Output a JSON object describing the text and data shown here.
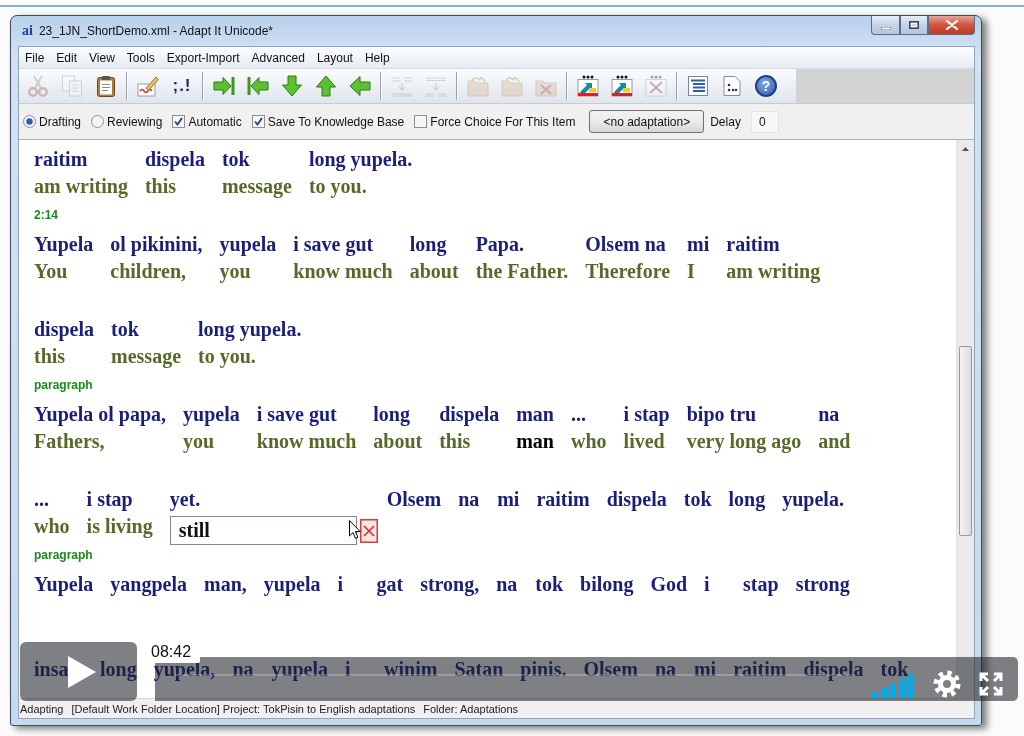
{
  "window": {
    "logo": "ai",
    "title": "23_1JN_ShortDemo.xml - Adapt It Unicode*"
  },
  "menu": [
    "File",
    "Edit",
    "View",
    "Tools",
    "Export-Import",
    "Advanced",
    "Layout",
    "Help"
  ],
  "toolbar": [
    [
      {
        "kind": "cut",
        "disabled": true
      },
      {
        "kind": "copy",
        "disabled": true
      },
      {
        "kind": "paste",
        "disabled": false
      }
    ],
    [
      {
        "kind": "pen-sheet",
        "disabled": false
      },
      {
        "kind": "text",
        "label": ";.!",
        "disabled": false
      }
    ],
    [
      {
        "kind": "jump-forward",
        "disabled": false
      },
      {
        "kind": "jump-back",
        "disabled": false
      },
      {
        "kind": "down",
        "disabled": false
      },
      {
        "kind": "up",
        "disabled": false
      },
      {
        "kind": "left",
        "disabled": false
      }
    ],
    [
      {
        "kind": "merge",
        "disabled": true
      },
      {
        "kind": "split",
        "disabled": true
      }
    ],
    [
      {
        "kind": "folder",
        "disabled": true
      },
      {
        "kind": "folder",
        "disabled": true
      },
      {
        "kind": "folder-cross",
        "disabled": true
      }
    ],
    [
      {
        "kind": "picture-arrow",
        "disabled": false
      },
      {
        "kind": "picture-arrow",
        "disabled": false
      },
      {
        "kind": "picture-cross",
        "disabled": true
      }
    ],
    [
      {
        "kind": "list",
        "disabled": false
      },
      {
        "kind": "sheet-dots",
        "disabled": false
      },
      {
        "kind": "help",
        "label": "?",
        "disabled": false
      }
    ]
  ],
  "modes": [
    {
      "label": "Drafting",
      "selected": true
    },
    {
      "label": "Reviewing",
      "selected": false
    }
  ],
  "options": [
    {
      "label": "Automatic",
      "checked": true
    },
    {
      "label": "Save To Knowledge Base",
      "checked": true
    },
    {
      "label": "Force Choice For This Item",
      "checked": false
    }
  ],
  "adaptation_button": "<no adaptation>",
  "delay": {
    "label": "Delay",
    "value": "0"
  },
  "strips": [
    {
      "piles": [
        {
          "source": "raitim",
          "target": "am writing"
        },
        {
          "source": "dispela",
          "target": "this"
        },
        {
          "source": "tok",
          "target": "message"
        },
        {
          "source": "long yupela.",
          "target": "to you."
        }
      ],
      "marker": "2:14"
    },
    {
      "piles": [
        {
          "source": "Yupela",
          "target": "You"
        },
        {
          "source": "ol pikinini,",
          "target": "children,"
        },
        {
          "source": "yupela",
          "target": "you"
        },
        {
          "source": "i save gut",
          "target": "know much"
        },
        {
          "source": "long",
          "target": "about"
        },
        {
          "source": "Papa.",
          "target": "the Father."
        },
        {
          "source": "Olsem na",
          "target": "Therefore"
        },
        {
          "source": "mi",
          "target": "I"
        },
        {
          "source": "raitim",
          "target": "am writing"
        }
      ]
    },
    {
      "piles": [
        {
          "source": "dispela",
          "target": "this"
        },
        {
          "source": "tok",
          "target": "message"
        },
        {
          "source": "long yupela.",
          "target": "to you."
        }
      ],
      "marker": "paragraph"
    },
    {
      "piles": [
        {
          "source": "Yupela ol papa,",
          "target": "Fathers,"
        },
        {
          "source": "yupela",
          "target": "you"
        },
        {
          "source": "i save gut",
          "target": "know much"
        },
        {
          "source": "long",
          "target": "about"
        },
        {
          "source": "dispela",
          "target": "this"
        },
        {
          "source": "man",
          "target": "man",
          "color": "#000000"
        },
        {
          "source": "...",
          "target": "who"
        },
        {
          "source": "i stap",
          "target": "lived"
        },
        {
          "source": "bipo tru",
          "target": "very long ago"
        },
        {
          "source": "na",
          "target": "and"
        }
      ]
    },
    {
      "piles": [
        {
          "source": "...",
          "target": "who"
        },
        {
          "source": "i stap",
          "target": "is living"
        },
        {
          "source": "yet.",
          "phrase_box": "still"
        },
        {
          "source": "Olsem"
        },
        {
          "source": "na"
        },
        {
          "source": "mi"
        },
        {
          "source": "raitim"
        },
        {
          "source": "dispela"
        },
        {
          "source": "tok"
        },
        {
          "source": "long"
        },
        {
          "source": "yupela."
        }
      ],
      "marker": "paragraph"
    },
    {
      "piles": [
        {
          "source": "Yupela"
        },
        {
          "source": "yangpela"
        },
        {
          "source": "man,"
        },
        {
          "source": "yupela"
        },
        {
          "source": "i"
        },
        {
          "source": "gat"
        },
        {
          "source": "strong,"
        },
        {
          "source": "na"
        },
        {
          "source": "tok"
        },
        {
          "source": "bilong"
        },
        {
          "source": "God"
        },
        {
          "source": "i"
        },
        {
          "source": "stap"
        },
        {
          "source": "strong"
        }
      ]
    },
    {
      "piles": [
        {
          "source": "insa"
        },
        {
          "source": "long"
        },
        {
          "source": "yupela,"
        },
        {
          "source": "na"
        },
        {
          "source": "yupela"
        },
        {
          "source": "i"
        },
        {
          "source": "winim"
        },
        {
          "source": "Satan"
        },
        {
          "source": "pinis."
        },
        {
          "source": "Olsem"
        },
        {
          "source": "na"
        },
        {
          "source": "mi"
        },
        {
          "source": "raitim"
        },
        {
          "source": "dispela"
        },
        {
          "source": "tok"
        }
      ]
    }
  ],
  "status_bar": [
    "Adapting",
    "[Default Work Folder Location] Project: TokPisin to English adaptations",
    "Folder: Adaptations"
  ],
  "video_player": {
    "time_tooltip": "08:42"
  }
}
